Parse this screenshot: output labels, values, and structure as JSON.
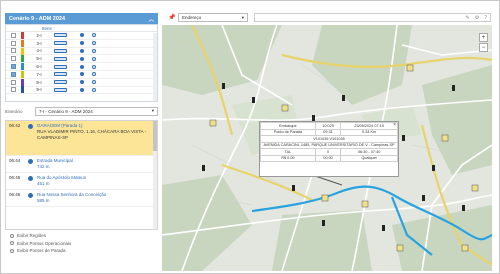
{
  "scenario": {
    "title": "Cenário 9 - ADM 2024",
    "collapse_icon": "chevron-up-icon"
  },
  "lines_table": {
    "header": "Itens",
    "rows": [
      {
        "label": "2-I",
        "color": "#d33c2c",
        "checked": false
      },
      {
        "label": "3-I",
        "color": "#e87a1c",
        "checked": false
      },
      {
        "label": "4-I",
        "color": "#f2c400",
        "checked": false
      },
      {
        "label": "5-I",
        "color": "#2ea44a",
        "checked": false
      },
      {
        "label": "6-I",
        "color": "#2d8bd6",
        "checked": true
      },
      {
        "label": "7-I",
        "color": "#c9c900",
        "checked": true
      },
      {
        "label": "8-I",
        "color": "#6a3fb5",
        "checked": false
      },
      {
        "label": "9-I",
        "color": "#2b4ea0",
        "checked": false
      }
    ]
  },
  "itinerary": {
    "label": "Itinerário",
    "value": "7-I - Cenário 9 - ADM 2024"
  },
  "stops": [
    {
      "time": "06:42",
      "name": "GARAGEM (Parada 1)",
      "detail": "RUA VLADIMIR PINTO, 1.16, CHÁCARA BOA VISTA - CAMPINAS-SP",
      "selected": true
    },
    {
      "time": "06:44",
      "name": "Estrada Municipal",
      "detail": "742 m",
      "selected": false
    },
    {
      "time": "06:45",
      "name": "Rua do Apóstolo Mateus",
      "detail": "451 m",
      "selected": false
    },
    {
      "time": "06:46",
      "name": "Rua Nossa Senhora da Conceição",
      "detail": "585 m",
      "selected": false
    }
  ],
  "options": [
    "Exibir Regiões",
    "Exibir Pontos Operacionais",
    "Exibir Pontos de Parada"
  ],
  "toolbar": {
    "address_select": "Endereço"
  },
  "popup": {
    "r1": [
      "Embarque",
      "10:029",
      "23/05/2024 07:19"
    ],
    "r2": [
      "Ponto de Parada",
      "09:31",
      "0.34 Km"
    ],
    "r3": "V101035 V101035",
    "r4": "AVENIDA CARACINI, 1485, PARQUE UNIVERSITÁRIO DE V - Campinas-SP",
    "r5": [
      "TAL",
      "0",
      "06:30 - 07:40"
    ],
    "r6": [
      "R$ 0.00",
      "00:00",
      "Qualquer"
    ]
  }
}
